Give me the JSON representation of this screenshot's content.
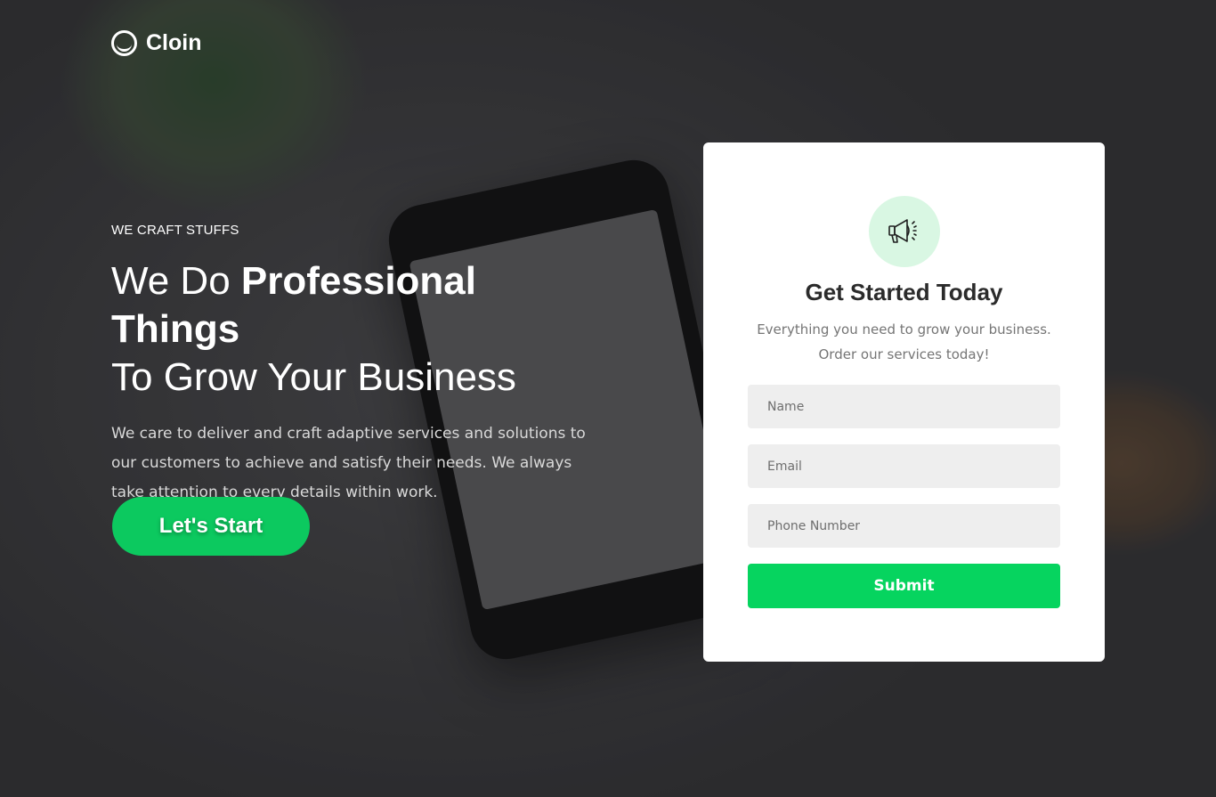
{
  "brand": {
    "name": "Cloin",
    "icon": "cloin-logo-icon"
  },
  "hero": {
    "eyebrow": "WE CRAFT STUFFS",
    "headline_light_1": "We Do ",
    "headline_bold": "Professional Things",
    "headline_light_2": "To Grow Your Business",
    "description": "We care to deliver and craft adaptive services and solutions to our customers to achieve and satisfy their needs. We always take attention to every details within work.",
    "cta_label": "Let's Start"
  },
  "form": {
    "icon": "megaphone-icon",
    "title": "Get Started Today",
    "subtitle_line1": "Everything you need to grow your business.",
    "subtitle_line2": "Order our services today!",
    "name_placeholder": "Name",
    "email_placeholder": "Email",
    "phone_placeholder": "Phone Number",
    "submit_label": "Submit"
  },
  "colors": {
    "accent": "#06d45f",
    "icon_bg": "#d9f7e3"
  }
}
